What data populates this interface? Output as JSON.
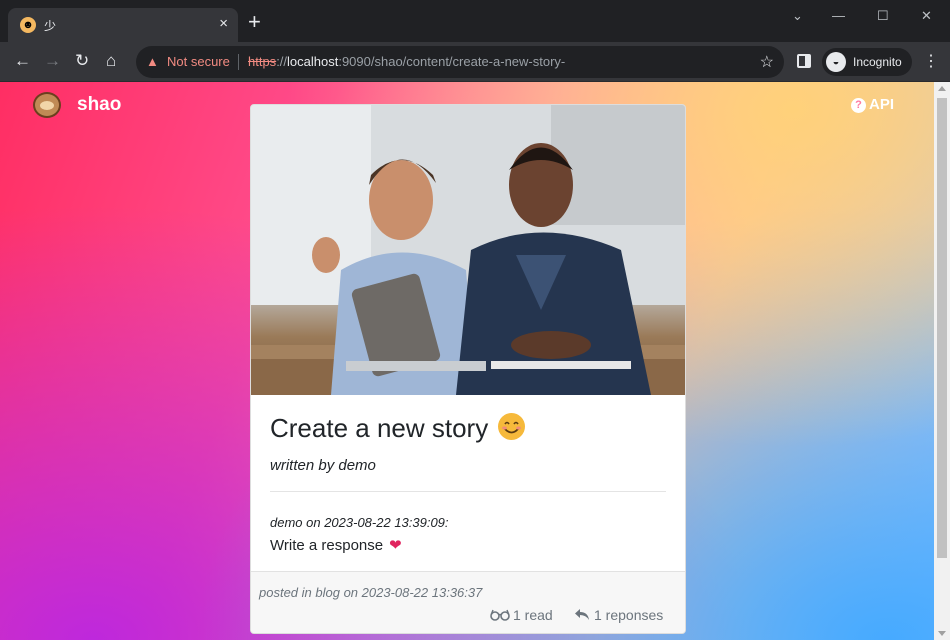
{
  "browser": {
    "tab_title": "少",
    "tab_close": "×",
    "new_tab": "+",
    "omnibox": {
      "warning_text": "Not secure",
      "url_scheme": "https",
      "url_sep": "://",
      "url_host": "localhost",
      "url_rest": ":9090/shao/content/create-a-new-story-"
    },
    "profile_label": "Incognito"
  },
  "site": {
    "brand": "shao",
    "api_label": "API",
    "api_icon": "?"
  },
  "card": {
    "title": "Create a new story",
    "author": "written by demo",
    "response": {
      "meta": "demo on 2023-08-22 13:39:09:",
      "text": "Write a response",
      "heart": "❤"
    },
    "footer": {
      "posted": "posted in blog on 2023-08-22 13:36:37",
      "reads": "1 read",
      "responses": "1 reponses"
    }
  },
  "colors": {
    "not_secure": "#f28b82",
    "heart": "#e0245e",
    "muted": "#6c757d"
  },
  "icons": [
    "sloth-icon",
    "close-icon",
    "plus-icon",
    "back-icon",
    "forward-icon",
    "reload-icon",
    "home-icon",
    "warning-icon",
    "star-icon",
    "side-panel-icon",
    "incognito-icon",
    "menu-icon",
    "help-icon",
    "smile-emoji-icon",
    "heart-icon",
    "glasses-icon",
    "reply-icon"
  ]
}
